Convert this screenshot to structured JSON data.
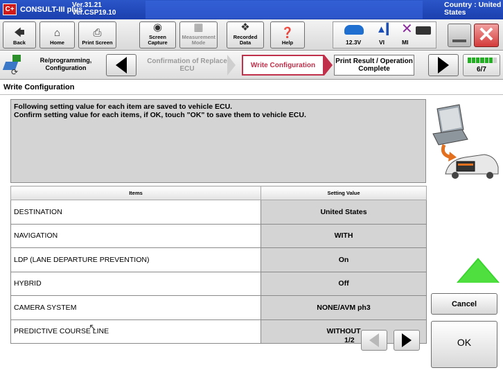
{
  "titlebar": {
    "app_name": "CONSULT-III plus",
    "logo": "C+",
    "version_line1": "Ver.31.21",
    "version_line2": "Ver.CSP19.10",
    "country_line1": "Country : United",
    "country_line2": "States"
  },
  "toolbar": {
    "back": "Back",
    "home": "Home",
    "print_screen": "Print Screen",
    "screen_capture": "Screen Capture",
    "measurement_mode": "Measurement Mode",
    "recorded_data": "Recorded Data",
    "help": "Help",
    "voltage": "12.3V",
    "vi": "VI",
    "mi": "MI",
    "icons": {
      "back": "back-arrow-icon",
      "home": "home-icon",
      "print_screen": "printer-icon",
      "screen_capture": "camera-icon",
      "measurement_mode": "measurement-icon",
      "recorded_data": "recorded-data-icon",
      "help": "help-icon"
    }
  },
  "stepbar": {
    "title": "Re/programming, Configuration",
    "steps": [
      {
        "label": "Confirmation of Replace ECU",
        "state": "past"
      },
      {
        "label": "Write Configuration",
        "state": "current"
      },
      {
        "label": "Print Result / Operation Complete",
        "state": "next"
      }
    ],
    "page": "6/7",
    "progress_filled_segments": 6,
    "progress_total_segments": 7
  },
  "heading": "Write Configuration",
  "message": {
    "line1": "Following setting value for each item are saved to vehicle ECU.",
    "line2": "Confirm setting value for each items, if OK, touch \"OK\" to save them to vehicle ECU."
  },
  "table": {
    "headers": {
      "items": "Items",
      "value": "Setting Value"
    },
    "rows": [
      {
        "item": "DESTINATION",
        "value": "United States"
      },
      {
        "item": "NAVIGATION",
        "value": "WITH"
      },
      {
        "item": "LDP (LANE DEPARTURE PREVENTION)",
        "value": "On"
      },
      {
        "item": "HYBRID",
        "value": "Off"
      },
      {
        "item": "CAMERA SYSTEM",
        "value": "NONE/AVM ph3"
      },
      {
        "item": "PREDICTIVE COURSE LINE",
        "value": "WITHOUT"
      }
    ]
  },
  "pager": {
    "text": "1/2"
  },
  "buttons": {
    "cancel": "Cancel",
    "ok": "OK"
  },
  "colors": {
    "titlebar": "#1b3fae",
    "current_step": "#c0304a",
    "progress": "#22b022",
    "ok_pointer": "#35d52a",
    "value_cell": "#d4d4d4"
  }
}
